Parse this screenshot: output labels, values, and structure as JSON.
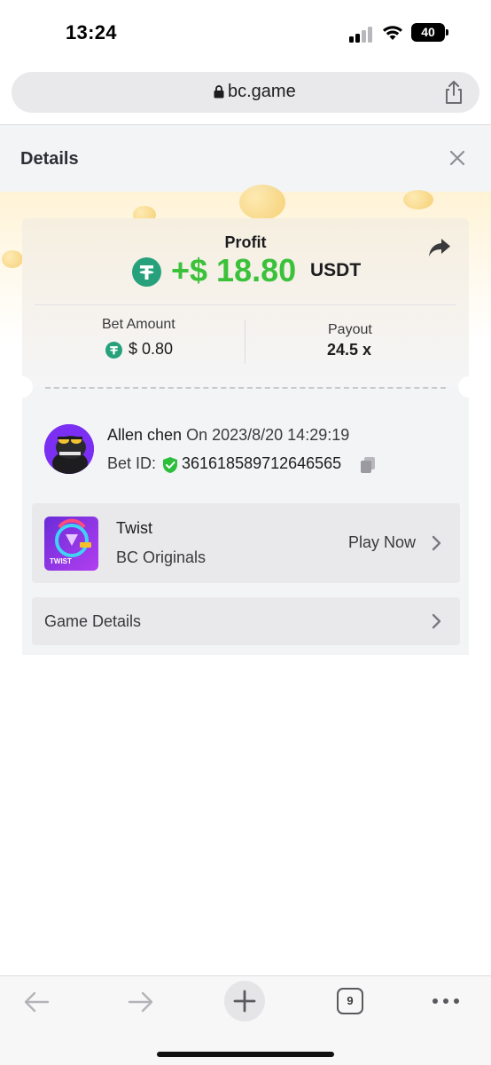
{
  "status_bar": {
    "time": "13:24",
    "battery": "40",
    "icons": [
      "cellular-signal-icon",
      "wifi-icon",
      "battery-icon"
    ]
  },
  "browser": {
    "url": "bc.game",
    "icons": [
      "lock-icon",
      "share-icon"
    ]
  },
  "panel": {
    "title": "Details",
    "close_icon": "close-icon"
  },
  "profit": {
    "label": "Profit",
    "value": "+$ 18.80",
    "currency": "USDT",
    "share_icon": "forward-arrow-icon"
  },
  "stats": {
    "bet_amount_label": "Bet Amount",
    "bet_amount_value": "$ 0.80",
    "payout_label": "Payout",
    "payout_value": "24.5 x"
  },
  "user": {
    "name": "Allen chen",
    "when": "On 2023/8/20 14:29:19",
    "bet_id_label": "Bet ID:",
    "bet_id": "361618589712646565"
  },
  "game": {
    "name": "Twist",
    "provider": "BC Originals",
    "play_label": "Play Now",
    "thumb_text": "TWIST"
  },
  "game_details": {
    "label": "Game Details"
  },
  "toolbar": {
    "tab_count": "9",
    "icons": [
      "back-arrow-icon",
      "forward-arrow-icon",
      "plus-icon",
      "tabs-icon",
      "more-icon"
    ]
  },
  "colors": {
    "profit_green": "#3cc13b",
    "tether_green": "#26a17b",
    "avatar_purple": "#7b2ff2",
    "panel_bg": "#f3f4f6"
  }
}
